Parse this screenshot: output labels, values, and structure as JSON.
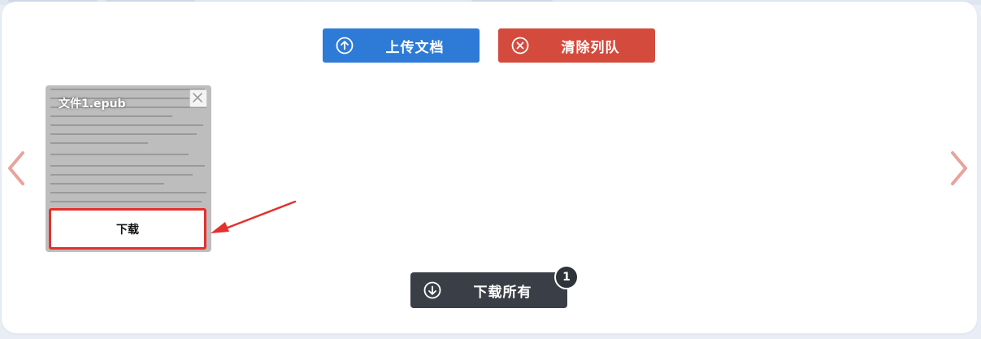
{
  "toolbar": {
    "upload_label": "上传文档",
    "clear_label": "清除列队"
  },
  "file_card": {
    "file_name": "文件1.epub",
    "download_label": "下载",
    "close_icon": "close-icon"
  },
  "footer": {
    "download_all_label": "下载所有",
    "file_count": "1"
  },
  "icons": {
    "upload": "arrow-up-circle-icon",
    "clear": "x-circle-icon",
    "download_all": "arrow-down-circle-icon",
    "prev": "chevron-left-icon",
    "next": "chevron-right-icon"
  },
  "colors": {
    "upload_button": "#2d7bd6",
    "clear_button": "#d44b3d",
    "download_all_button": "#3a3f47",
    "highlight_border": "#e3312e",
    "nav_arrow": "#e8a39b"
  }
}
